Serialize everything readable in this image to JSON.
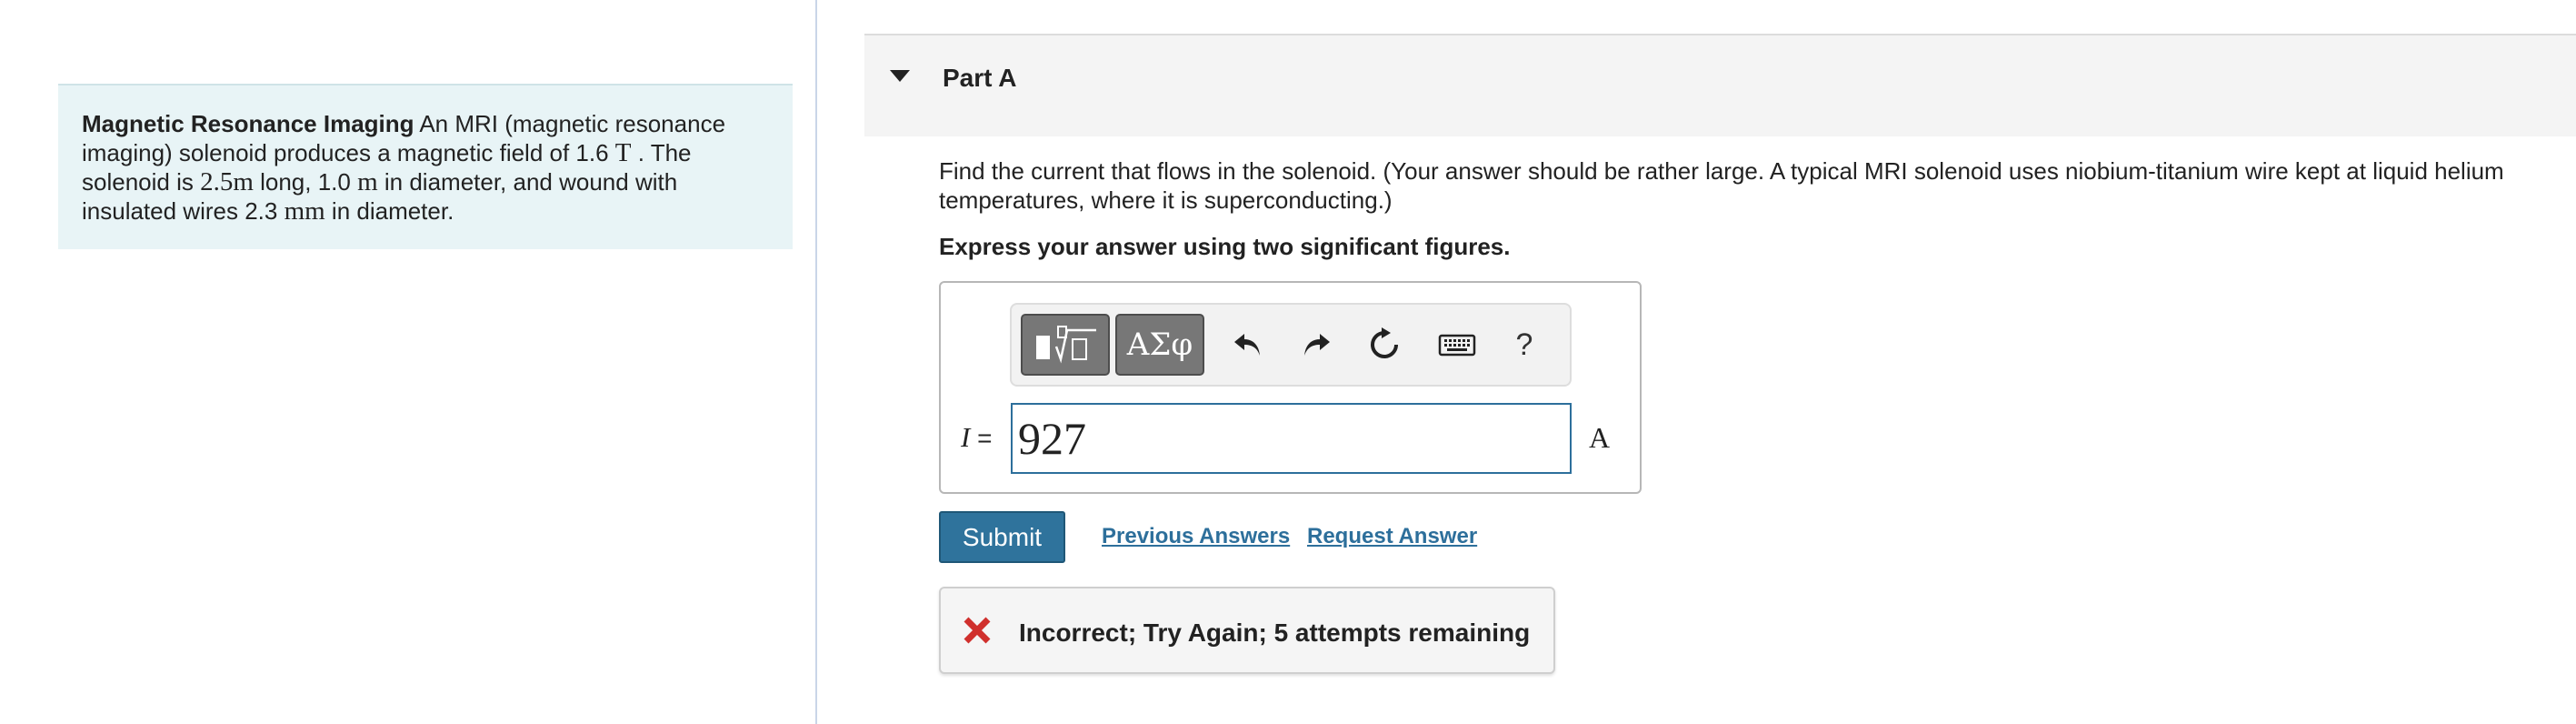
{
  "intro": {
    "title": "Magnetic Resonance Imaging",
    "text_1": " An MRI (magnetic resonance imaging) solenoid produces a magnetic field of 1.6 ",
    "unit_T": "T",
    "text_2": " . The solenoid is ",
    "length": "2.5m",
    "text_3": " long, 1.0 ",
    "unit_m": "m",
    "text_4": " in diameter, and wound with insulated wires 2.3 ",
    "unit_mm": "mm",
    "text_5": " in diameter."
  },
  "part": {
    "title": "Part A"
  },
  "question": {
    "text": "Find the current that flows in the solenoid. (Your answer should be rather large. A typical MRI solenoid uses niobium-titanium wire kept at liquid helium temperatures, where it is superconducting.)",
    "instruction": "Express your answer using two significant figures."
  },
  "toolbar": {
    "templates_icon": "templates-icon",
    "greek_label": "ΑΣφ",
    "undo_icon": "undo-icon",
    "redo_icon": "redo-icon",
    "reset_icon": "reset-icon",
    "keyboard_icon": "keyboard-icon",
    "help_label": "?"
  },
  "answer": {
    "variable": "I",
    "equals": "=",
    "value": "927",
    "unit": "A"
  },
  "actions": {
    "submit_label": "Submit",
    "previous_answers_label": "Previous Answers",
    "request_answer_label": "Request Answer"
  },
  "feedback": {
    "icon": "x-icon",
    "text": "Incorrect; Try Again; 5 attempts remaining",
    "color": "#d0302d"
  },
  "colors": {
    "intro_bg": "#e8f4f6",
    "accent": "#2f739c",
    "link": "#2d6f9b"
  }
}
